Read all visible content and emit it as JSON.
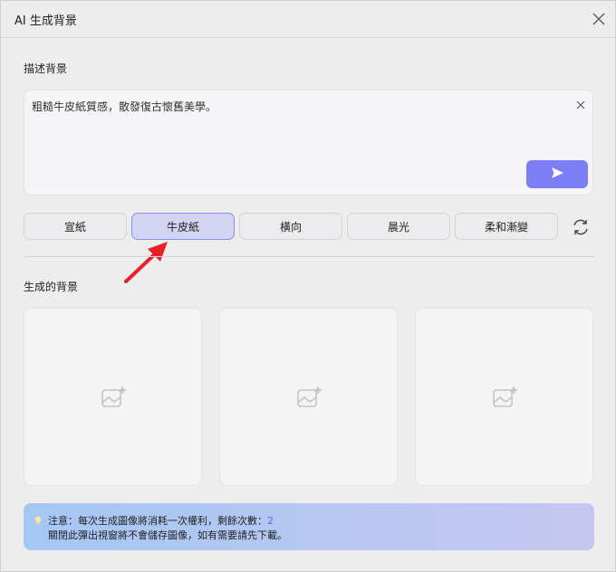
{
  "dialog": {
    "title": "AI 生成背景"
  },
  "describe": {
    "label": "描述背景",
    "value": "粗糙牛皮紙質感，散發復古懷舊美學。"
  },
  "styles": [
    {
      "label": "宣紙",
      "active": false
    },
    {
      "label": "牛皮紙",
      "active": true
    },
    {
      "label": "橫向",
      "active": false
    },
    {
      "label": "晨光",
      "active": false
    },
    {
      "label": "柔和漸變",
      "active": false
    }
  ],
  "generated": {
    "label": "生成的背景"
  },
  "notice": {
    "line1": "注意：每次生成圖像將消耗一次權利，剩餘次數：",
    "remaining": "2",
    "line2": "關閉此彈出視窗將不會儲存圖像，如有需要請先下載。"
  },
  "colors": {
    "accent": "#7b7ef5",
    "annotation_arrow": "#e8202a"
  }
}
